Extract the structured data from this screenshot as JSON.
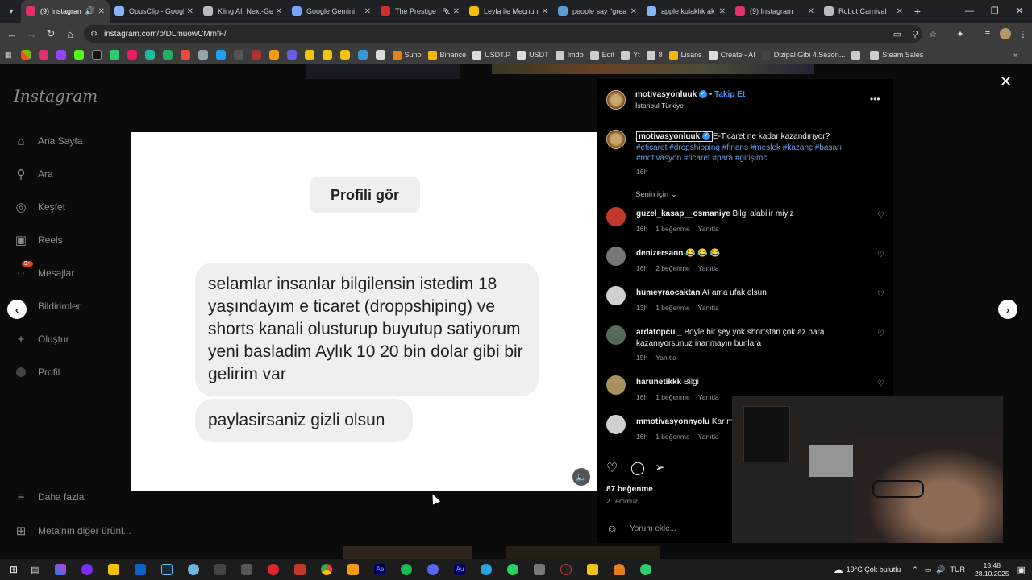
{
  "browser": {
    "tabs": [
      {
        "title": "(9) Instagram",
        "color": "#e1306c",
        "active": true
      },
      {
        "title": "OpusClip - Googl",
        "color": "#8ab4f8"
      },
      {
        "title": "Kling AI: Next-Ge",
        "color": "#bbbbbb"
      },
      {
        "title": "Google Gemini",
        "color": "#7aa2ff"
      },
      {
        "title": "The Prestige | Rot",
        "color": "#d32f2f"
      },
      {
        "title": "Leyla ile Mecnun",
        "color": "#f2c200"
      },
      {
        "title": "people say \"great",
        "color": "#5a9bd5"
      },
      {
        "title": "apple kulaklık ak",
        "color": "#8ab4f8"
      },
      {
        "title": "(9) Instagram",
        "color": "#e1306c"
      },
      {
        "title": "Robot Carnival",
        "color": "#bbbbbb"
      }
    ],
    "url": "instagram.com/p/DLmuowCMmfF/",
    "bookmarks": [
      {
        "label": "Suno",
        "color": "#e67e22"
      },
      {
        "label": "Binance",
        "color": "#f0b90b"
      },
      {
        "label": "USDT.P",
        "color": "#dddddd"
      },
      {
        "label": "USDT",
        "color": "#dddddd"
      },
      {
        "label": "Imdb",
        "color": "#cccccc"
      },
      {
        "label": "Edit",
        "color": "#cccccc"
      },
      {
        "label": "Yt",
        "color": "#cccccc"
      },
      {
        "label": "8",
        "color": "#cccccc"
      },
      {
        "label": "Lisans",
        "color": "#f0b90b"
      },
      {
        "label": "Create - AI",
        "color": "#dddddd"
      },
      {
        "label": "Dizipal Gibi 4.Sezon...",
        "color": "#444444"
      },
      {
        "label": "",
        "color": "#cccccc"
      },
      {
        "label": "Steam Sales",
        "color": "#cccccc"
      }
    ]
  },
  "sidebar": {
    "logo": "Instagram",
    "items": [
      {
        "label": "Ana Sayfa",
        "icon": "home-icon"
      },
      {
        "label": "Ara",
        "icon": "search-icon"
      },
      {
        "label": "Keşfet",
        "icon": "compass-icon"
      },
      {
        "label": "Reels",
        "icon": "reels-icon"
      },
      {
        "label": "Mesajlar",
        "icon": "messenger-icon",
        "badge": "9+"
      },
      {
        "label": "Bildirimler",
        "icon": "heart-icon"
      },
      {
        "label": "Oluştur",
        "icon": "plus-icon"
      },
      {
        "label": "Profil",
        "icon": "profile-icon"
      }
    ],
    "more": "Daha fazla",
    "meta": "Meta'nın diğer ürünl..."
  },
  "post": {
    "profile_button": "Profili gör",
    "message1": "selamlar insanlar bilgilensin istedim 18 yaşındayım e ticaret (droppshiping) ve shorts kanali olusturup buyutup satiyorum yeni basladim Aylık 10 20 bin dolar gibi bir gelirim var",
    "message2": "paylasirsaniz gizli olsun"
  },
  "panel": {
    "username": "motivasyonluuk",
    "follow": "Takip Et",
    "location": "İstanbul Türkiye",
    "caption_text": "E-Ticaret ne kadar kazandırıyor?",
    "hashtags": "#eticaret #dropshipping #finans #meslek #kazanç #başarı #motivasyon #ticaret #para #girişimci",
    "caption_time": "16h",
    "sort_label": "Senin için",
    "comments": [
      {
        "user": "guzel_kasap__osmaniye",
        "text": "Bilgi alabilir miyiz",
        "time": "16h",
        "likes": "1 beğenme",
        "reply": "Yanıtla",
        "color": "#c0392b"
      },
      {
        "user": "denizersann",
        "text": "😂 😂 😂",
        "time": "16h",
        "likes": "2 beğenme",
        "reply": "Yanıtla",
        "color": "#777777"
      },
      {
        "user": "humeyraocaktan",
        "text": "At ama ufak olsun",
        "time": "13h",
        "likes": "1 beğenme",
        "reply": "Yanıtla",
        "color": "#d0d0d0"
      },
      {
        "user": "ardatopcu._",
        "text": "Böyle bir şey yok shortstan çok az para kazanıyorsunuz inanmayın bunlara",
        "time": "15h",
        "likes": "",
        "reply": "Yanıtla",
        "color": "#556b5a"
      },
      {
        "user": "harunetikkk",
        "text": "Bilgi",
        "time": "16h",
        "likes": "1 beğenme",
        "reply": "Yanıtla",
        "color": "#a89060"
      },
      {
        "user": "mmotivasyonnyolu",
        "text": "Kar m",
        "time": "16h",
        "likes": "1 beğenme",
        "reply": "Yanıtla",
        "color": "#d0d0d0"
      }
    ],
    "likes_count": "87 beğenme",
    "date": "2 Temmuz",
    "comment_placeholder": "Yorum ekle..."
  },
  "taskbar": {
    "weather": "19°C  Çok bulutlu",
    "lang": "TUR",
    "time": "18:48",
    "date": "28.10.2025"
  }
}
